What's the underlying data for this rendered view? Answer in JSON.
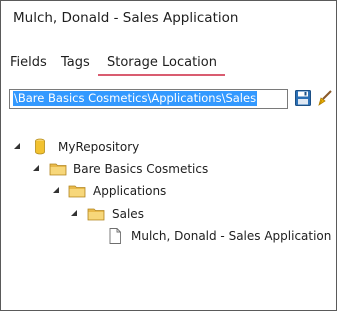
{
  "window": {
    "title": "Mulch, Donald - Sales Application"
  },
  "tabs": [
    {
      "label": "Fields"
    },
    {
      "label": "Tags"
    },
    {
      "label": "Storage Location",
      "active": true
    }
  ],
  "colors": {
    "tab_underline": "#d95c70",
    "selection": "#3399ff"
  },
  "path": {
    "value": "\\Bare Basics Cosmetics\\Applications\\Sales"
  },
  "icons": {
    "save": "save-icon",
    "clear": "clear-icon"
  },
  "tree": [
    {
      "label": "MyRepository",
      "icon": "database-icon",
      "expanded": true
    },
    {
      "label": "Bare Basics Cosmetics",
      "icon": "folder-icon",
      "expanded": true
    },
    {
      "label": "Applications",
      "icon": "folder-icon",
      "expanded": true
    },
    {
      "label": "Sales",
      "icon": "folder-icon",
      "expanded": true
    },
    {
      "label": "Mulch, Donald - Sales Application",
      "icon": "document-icon"
    }
  ]
}
